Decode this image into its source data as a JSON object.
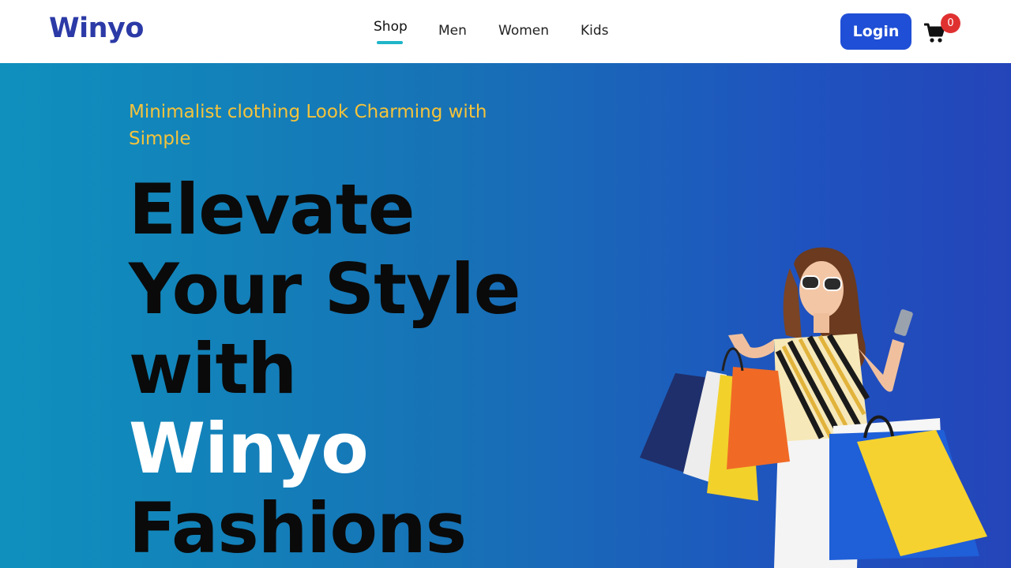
{
  "navbar": {
    "logo": "Winyo",
    "links": [
      {
        "label": "Shop",
        "active": true
      },
      {
        "label": "Men",
        "active": false
      },
      {
        "label": "Women",
        "active": false
      },
      {
        "label": "Kids",
        "active": false
      }
    ],
    "login_label": "Login",
    "cart_icon": "shopping-cart-icon",
    "cart_count": "0"
  },
  "hero": {
    "tagline": "Minimalist clothing Look Charming with Simple",
    "headline_lines": [
      "Elevate",
      "Your Style",
      "with"
    ],
    "headline_brand": "Winyo",
    "headline_last": "Fashions",
    "image": "woman-with-shopping-bags"
  },
  "colors": {
    "brand": "#2b3aa6",
    "accent_underline": "#1fb5c9",
    "login_button": "#1f4fd6",
    "badge": "#e03131",
    "tagline": "#f5c33b",
    "hero_gradient_start": "#0f90bd",
    "hero_gradient_end": "#2445b9"
  }
}
